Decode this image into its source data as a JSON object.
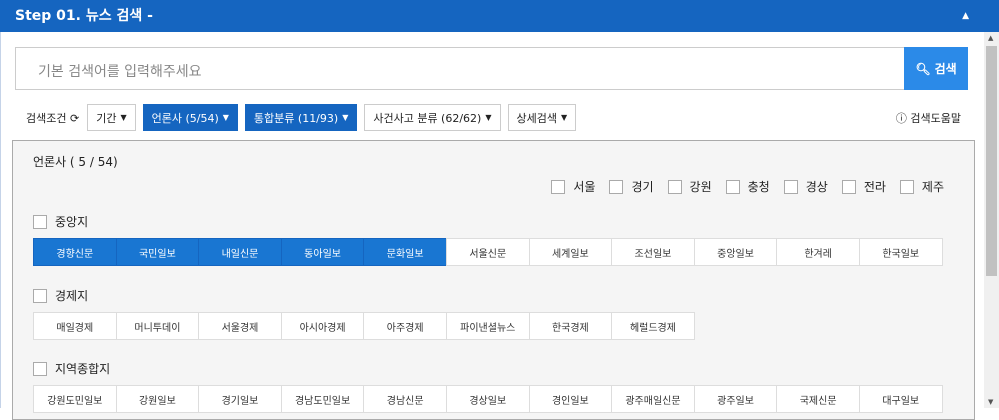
{
  "header": {
    "title": "Step 01. 뉴스 검색 -"
  },
  "search": {
    "placeholder": "기본 검색어를 입력해주세요",
    "button": "검색"
  },
  "toolbar": {
    "label": "검색조건",
    "filters": [
      {
        "label": "기간",
        "active": false
      },
      {
        "label": "언론사 (5/54)",
        "active": true
      },
      {
        "label": "통합분류 (11/93)",
        "active": true
      },
      {
        "label": "사건사고 분류 (62/62)",
        "active": false
      },
      {
        "label": "상세검색",
        "active": false
      }
    ],
    "help": "검색도움말"
  },
  "panel": {
    "title": "언론사 ( 5 / 54)",
    "regions": [
      "서울",
      "경기",
      "강원",
      "충청",
      "경상",
      "전라",
      "제주"
    ],
    "groups": [
      {
        "name": "중앙지",
        "items": [
          "경향신문",
          "국민일보",
          "내일신문",
          "동아일보",
          "문화일보",
          "서울신문",
          "세계일보",
          "조선일보",
          "중앙일보",
          "한겨레",
          "한국일보"
        ],
        "selected": [
          0,
          1,
          2,
          3,
          4
        ]
      },
      {
        "name": "경제지",
        "items": [
          "매일경제",
          "머니투데이",
          "서울경제",
          "아시아경제",
          "아주경제",
          "파이낸셜뉴스",
          "한국경제",
          "헤럴드경제"
        ],
        "selected": []
      },
      {
        "name": "지역종합지",
        "items": [
          "강원도민일보",
          "강원일보",
          "경기일보",
          "경남도민일보",
          "경남신문",
          "경상일보",
          "경인일보",
          "광주매일신문",
          "광주일보",
          "국제신문",
          "대구일보"
        ],
        "selected": []
      }
    ]
  }
}
